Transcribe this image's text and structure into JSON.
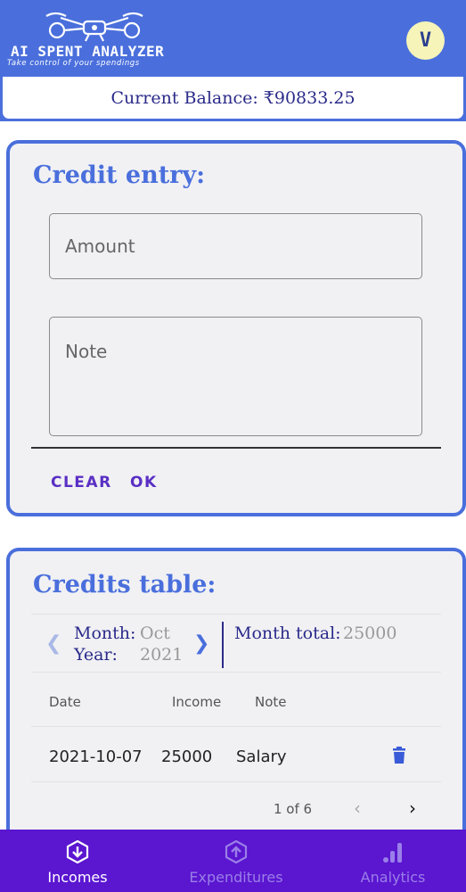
{
  "header": {
    "logo_title": "AI SPENT ANALYZER",
    "logo_tagline": "Take control of your spendings",
    "avatar_initial": "V"
  },
  "balance": {
    "text": "Current Balance: ₹90833.25"
  },
  "credit_entry": {
    "title": "Credit entry:",
    "amount_placeholder": "Amount",
    "note_placeholder": "Note",
    "clear_label": "CLEAR",
    "ok_label": "OK"
  },
  "credits_table": {
    "title": "Credits table:",
    "month_label": "Month:",
    "month_value": "Oct",
    "year_label": "Year:",
    "year_value": "2021",
    "month_total_label": "Month total:",
    "month_total_value": "25000",
    "columns": [
      "Date",
      "Income",
      "Note"
    ],
    "rows": [
      {
        "date": "2021-10-07",
        "income": "25000",
        "note": "Salary"
      }
    ],
    "pagination": "1 of 6"
  },
  "bottom_nav": [
    {
      "label": "Incomes",
      "active": true
    },
    {
      "label": "Expenditures",
      "active": false
    },
    {
      "label": "Analytics",
      "active": false
    }
  ],
  "colors": {
    "primary": "#4a6fdc",
    "bottom_nav": "#5b16d0",
    "button_text": "#5a2fc4",
    "dark_text": "#2a2a8a"
  }
}
